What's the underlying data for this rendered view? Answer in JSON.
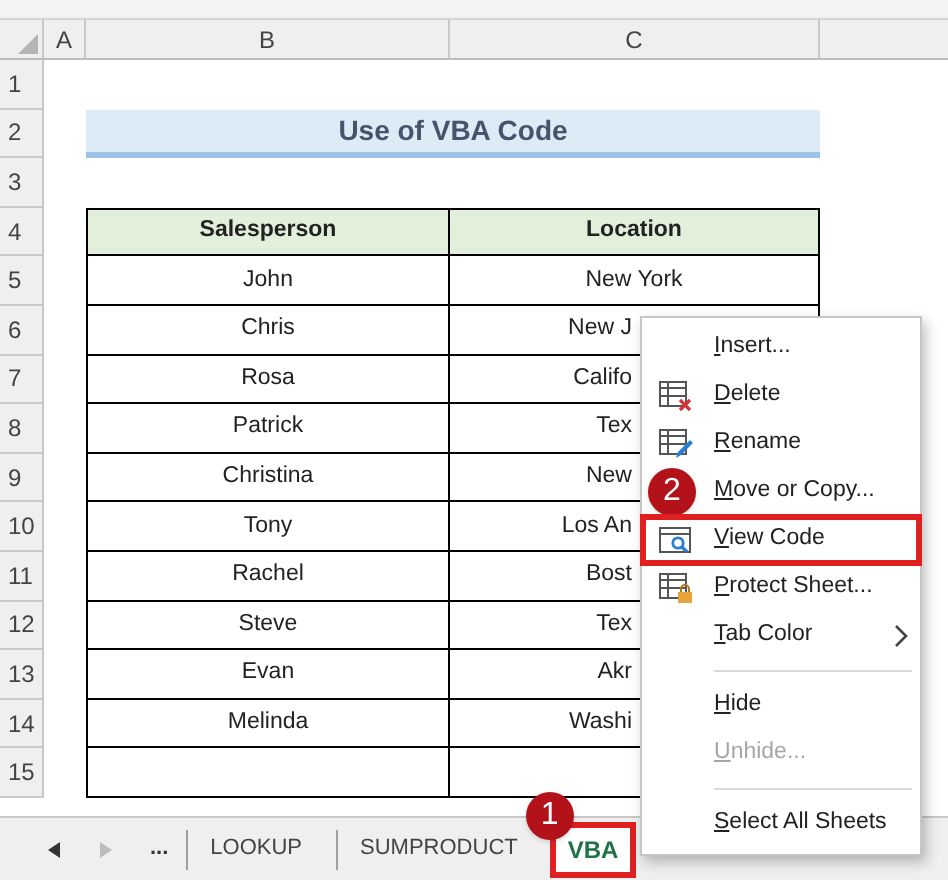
{
  "column_headers": [
    "A",
    "B",
    "C"
  ],
  "row_numbers": [
    "1",
    "2",
    "3",
    "4",
    "5",
    "6",
    "7",
    "8",
    "9",
    "10",
    "11",
    "12",
    "13",
    "14",
    "15"
  ],
  "title": "Use of VBA Code",
  "table": {
    "columns": [
      "Salesperson",
      "Location"
    ],
    "rows": [
      {
        "salesperson": "John",
        "location": "New York"
      },
      {
        "salesperson": "Chris",
        "location": "New J"
      },
      {
        "salesperson": "Rosa",
        "location": "Califo"
      },
      {
        "salesperson": "Patrick",
        "location": "Tex"
      },
      {
        "salesperson": "Christina",
        "location": "New"
      },
      {
        "salesperson": "Tony",
        "location": "Los An"
      },
      {
        "salesperson": "Rachel",
        "location": "Bost"
      },
      {
        "salesperson": "Steve",
        "location": "Tex"
      },
      {
        "salesperson": "Evan",
        "location": "Akr"
      },
      {
        "salesperson": "Melinda",
        "location": "Washi"
      }
    ]
  },
  "context_menu": {
    "items": [
      {
        "kind": "item",
        "label": "Insert...",
        "disabled": false,
        "highlighted": false
      },
      {
        "kind": "item",
        "label": "Delete",
        "disabled": false,
        "highlighted": false
      },
      {
        "kind": "item",
        "label": "Rename",
        "disabled": false,
        "highlighted": false
      },
      {
        "kind": "item",
        "label": "Move or Copy...",
        "disabled": false,
        "highlighted": false,
        "badge": "2"
      },
      {
        "kind": "item",
        "label": "View Code",
        "disabled": false,
        "highlighted": true
      },
      {
        "kind": "item",
        "label": "Protect Sheet...",
        "disabled": false,
        "highlighted": false
      },
      {
        "kind": "submenu",
        "label": "Tab Color",
        "disabled": false,
        "highlighted": false
      },
      {
        "kind": "separator"
      },
      {
        "kind": "item",
        "label": "Hide",
        "disabled": false,
        "highlighted": false
      },
      {
        "kind": "item",
        "label": "Unhide...",
        "disabled": true,
        "highlighted": false
      },
      {
        "kind": "separator"
      },
      {
        "kind": "item",
        "label": "Select All Sheets",
        "disabled": false,
        "highlighted": false
      }
    ]
  },
  "sheet_tabs": {
    "more": "...",
    "tabs": [
      {
        "label": "LOOKUP",
        "selected": false,
        "highlighted": false
      },
      {
        "label": "SUMPRODUCT",
        "selected": false,
        "highlighted": false
      },
      {
        "label": "VBA",
        "selected": true,
        "highlighted": true,
        "badge": "1"
      }
    ]
  }
}
